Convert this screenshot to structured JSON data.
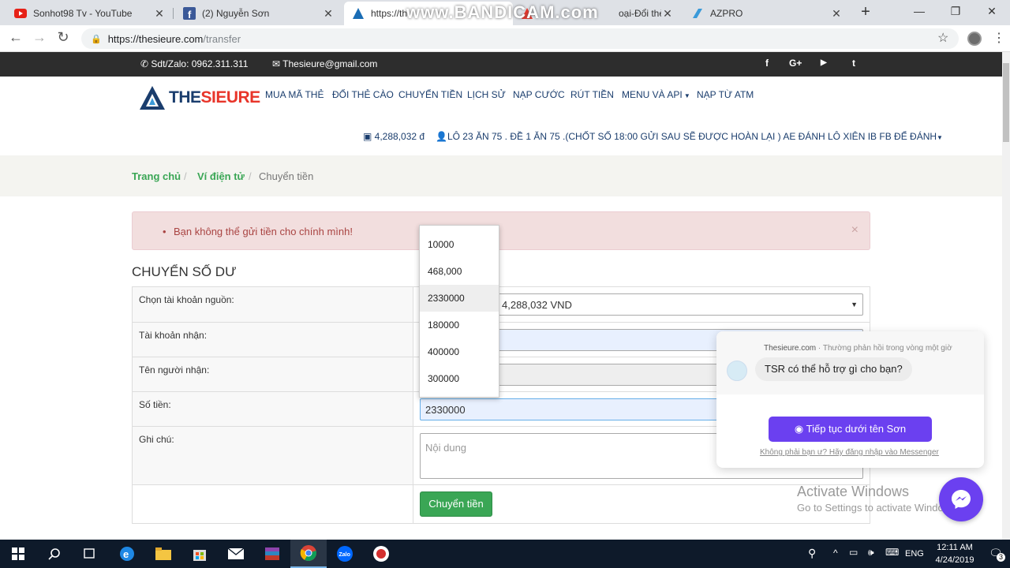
{
  "browser": {
    "tabs": [
      {
        "title": "Sonhot98 Tv - YouTube",
        "icon": "youtube-icon"
      },
      {
        "title": "(2) Nguyễn Sơn",
        "icon": "facebook-icon"
      },
      {
        "title": "https://th",
        "icon": "thesieure-icon"
      },
      {
        "title": "oại-Đổi thẻ cào",
        "icon": "thesieure-icon"
      },
      {
        "title": "AZPRO",
        "icon": "azpro-icon"
      }
    ],
    "url_host": "https://thesieure.com",
    "url_path": "/transfer",
    "watermark": "www.BANDICAM.com"
  },
  "site_top": {
    "phone": "Sdt/Zalo: 0962.311.311",
    "email": "Thesieure@gmail.com",
    "social": [
      "f",
      "G+",
      "▶",
      "t"
    ]
  },
  "logo": {
    "part1": "THE",
    "part2": "SIEURE"
  },
  "nav": {
    "items": [
      "MUA MÃ THẺ",
      "ĐỔI THẺ CÀO",
      "CHUYỂN TIỀN",
      "LỊCH SỬ",
      "NẠP CƯỚC",
      "RÚT TIỀN",
      "MENU VÀ API",
      "NẠP TỪ ATM"
    ],
    "balance": "4,288,032 đ",
    "notice": "LÔ 23 ĂN 75 . ĐỀ 1 ĂN 75 .(CHỐT SỐ 18:00 GỬI SAU SẼ ĐƯỢC HOÀN LẠI ) AE ĐÁNH LÔ XIÊN IB FB ĐỂ ĐÁNH"
  },
  "breadcrumb": {
    "home": "Trang chủ",
    "wallet": "Ví điện tử",
    "current": "Chuyển tiền",
    "sep": "/"
  },
  "alert": {
    "message": "Bạn không thể gửi tiền cho chính mình!",
    "close": "×"
  },
  "form": {
    "title": "CHUYỂN SỐ DƯ",
    "labels": {
      "source": "Chọn tài khoản nguồn:",
      "receiver": "Tài khoản nhận:",
      "receiver_name": "Tên người nhận:",
      "amount": "Số tiền:",
      "note": "Ghi chú:"
    },
    "source_value": "4,288,032 VND",
    "amount_value": "2330000",
    "note_placeholder": "Nội dung",
    "submit": "Chuyển tiền",
    "dropdown_options": [
      "10000",
      "468,000",
      "2330000",
      "180000",
      "400000",
      "300000"
    ],
    "dropdown_selected_index": 2
  },
  "messenger": {
    "source": "Thesieure.com",
    "reply_time": " · Thường phản hồi trong vòng một giờ",
    "greeting": "TSR có thể hỗ trợ gì cho bạn?",
    "continue_button": "Tiếp tục dưới tên Sơn",
    "not_you_link": "Không phải bạn ư? Hãy đăng nhập vào Messenger"
  },
  "activate_windows": {
    "line1": "Activate Windows",
    "line2": "Go to Settings to activate Windows."
  },
  "taskbar": {
    "language": "ENG",
    "time": "12:11 AM",
    "date": "4/24/2019",
    "notifications": "3"
  }
}
